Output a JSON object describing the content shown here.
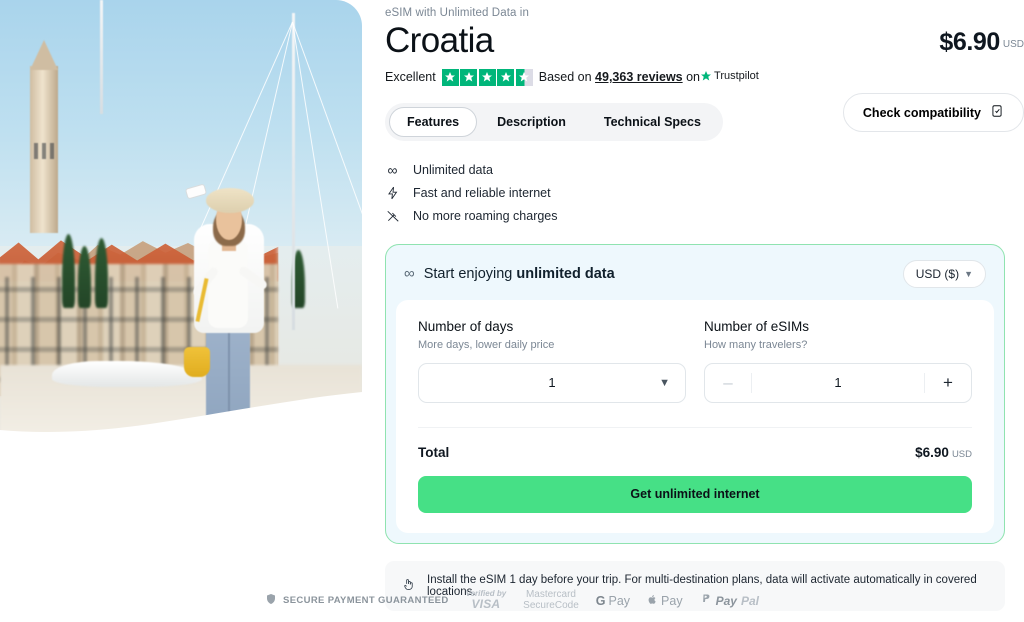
{
  "hero": {
    "alt": "woman-taking-selfie-in-croatian-harbour"
  },
  "header": {
    "eyebrow": "eSIM with Unlimited Data in",
    "title": "Croatia",
    "price": "$6.90",
    "price_currency": "USD"
  },
  "rating": {
    "label": "Excellent",
    "stars": 4.5,
    "based_on_prefix": "Based on",
    "reviews": "49,363 reviews",
    "on": "on",
    "platform": "Trustpilot",
    "star_color": "#00b67a"
  },
  "tabs": [
    {
      "label": "Features",
      "active": true
    },
    {
      "label": "Description",
      "active": false
    },
    {
      "label": "Technical Specs",
      "active": false
    }
  ],
  "compatibility": {
    "label": "Check compatibility",
    "icon": "device-check-icon"
  },
  "features": [
    {
      "icon": "infinity-icon",
      "label": "Unlimited data"
    },
    {
      "icon": "lightning-bolt-icon",
      "label": "Fast and reliable internet"
    },
    {
      "icon": "no-roaming-icon",
      "label": "No more roaming charges"
    }
  ],
  "order": {
    "heading_prefix": "Start enjoying",
    "heading_strong": "unlimited data",
    "heading_icon": "infinity-icon",
    "currency_selector": {
      "value": "USD ($)",
      "chevron": "⌄"
    },
    "days": {
      "label": "Number of days",
      "sublabel": "More days, lower daily price",
      "value": "1"
    },
    "esims": {
      "label": "Number of eSIMs",
      "sublabel": "How many travelers?",
      "value": "1",
      "minus": "–",
      "plus": "+"
    },
    "total_label": "Total",
    "total_value": "$6.90",
    "total_currency": "USD",
    "cta_label": "Get unlimited internet",
    "accent_color": "#46e086",
    "border_color": "#8fe3b0",
    "background_color": "#eef8fd"
  },
  "notice": {
    "icon": "tap-hand-icon",
    "text": "Install the eSIM 1 day before your trip. For multi-destination plans, data will activate automatically in covered locations."
  },
  "payments": {
    "secure_label": "SECURE PAYMENT GUARANTEED",
    "secure_icon": "shield-check-icon",
    "visa_top": "Verified by",
    "visa_bottom": "VISA",
    "mastercard_top": "Mastercard",
    "mastercard_bottom": "SecureCode",
    "gpay_g": "G",
    "gpay_pay": "Pay",
    "apay_mark": "␢",
    "apay_pay": "Pay",
    "paypal_pay": "Pay",
    "paypal_pal": "Pal"
  }
}
